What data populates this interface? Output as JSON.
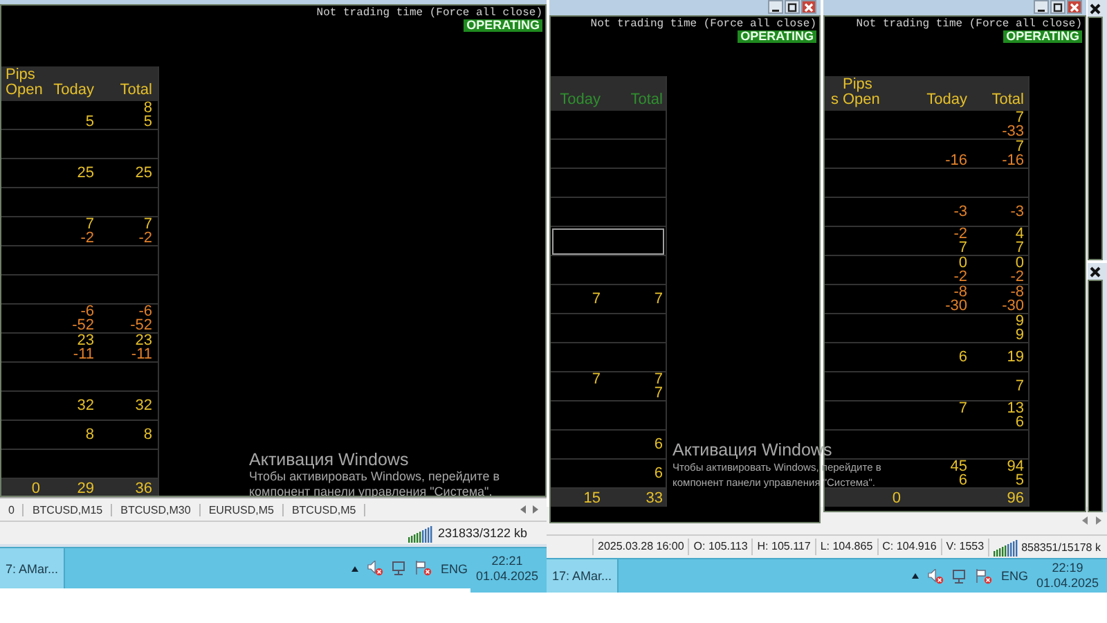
{
  "chart_windows": [
    {
      "has_controls": false,
      "message": "Not trading time (Force all close)",
      "badge": "OPERATING",
      "table": {
        "header_active": true,
        "group_heading": "Pips",
        "columns": [
          "Open",
          "Today",
          "Total"
        ],
        "groups": [
          {
            "kind": "values",
            "lines": [
              {
                "total": {
                  "text": "8",
                  "negative": false
                }
              },
              {
                "today": {
                  "text": "5",
                  "negative": false
                },
                "total": {
                  "text": "5",
                  "negative": false
                }
              }
            ]
          },
          {
            "kind": "empty"
          },
          {
            "kind": "values",
            "lines": [
              {
                "today": {
                  "text": "25",
                  "negative": false
                },
                "total": {
                  "text": "25",
                  "negative": false
                }
              }
            ]
          },
          {
            "kind": "empty"
          },
          {
            "kind": "values",
            "lines": [
              {
                "today": {
                  "text": "7",
                  "negative": false
                },
                "total": {
                  "text": "7",
                  "negative": false
                }
              },
              {
                "today": {
                  "text": "-2",
                  "negative": true
                },
                "total": {
                  "text": "-2",
                  "negative": true
                }
              }
            ]
          },
          {
            "kind": "empty"
          },
          {
            "kind": "empty"
          },
          {
            "kind": "values",
            "lines": [
              {
                "today": {
                  "text": "-6",
                  "negative": true
                },
                "total": {
                  "text": "-6",
                  "negative": true
                }
              },
              {
                "today": {
                  "text": "-52",
                  "negative": true
                },
                "total": {
                  "text": "-52",
                  "negative": true
                }
              }
            ]
          },
          {
            "kind": "values",
            "lines": [
              {
                "today": {
                  "text": "23",
                  "negative": false
                },
                "total": {
                  "text": "23",
                  "negative": false
                }
              },
              {
                "today": {
                  "text": "-11",
                  "negative": true
                },
                "total": {
                  "text": "-11",
                  "negative": true
                }
              }
            ]
          },
          {
            "kind": "empty"
          },
          {
            "kind": "values",
            "lines": [
              {
                "today": {
                  "text": "32",
                  "negative": false
                },
                "total": {
                  "text": "32",
                  "negative": false
                }
              }
            ]
          },
          {
            "kind": "values",
            "lines": [
              {
                "today": {
                  "text": "8",
                  "negative": false
                },
                "total": {
                  "text": "8",
                  "negative": false
                }
              }
            ]
          },
          {
            "kind": "empty"
          }
        ],
        "footer": {
          "open": "0",
          "today": "29",
          "total": "36"
        }
      },
      "tabs": [
        "0",
        "BTCUSD,M15",
        "BTCUSD,M30",
        "EURUSD,M5",
        "BTCUSD,M5"
      ],
      "memory": "231833/3122 kb"
    },
    {
      "has_controls": true,
      "message": "Not trading time (Force all close)",
      "badge": "OPERATING",
      "table": {
        "header_active": false,
        "columns": [
          "Today",
          "Total"
        ],
        "groups": [
          {
            "kind": "empty",
            "selected": false
          },
          {
            "kind": "empty",
            "selected": false
          },
          {
            "kind": "empty",
            "selected": false
          },
          {
            "kind": "empty",
            "selected": false
          },
          {
            "kind": "empty",
            "selected": true
          },
          {
            "kind": "empty",
            "selected": false
          },
          {
            "kind": "values",
            "selected": false,
            "lines": [
              {
                "today": {
                  "text": "7",
                  "negative": false
                },
                "total": {
                  "text": "7",
                  "negative": false
                }
              }
            ]
          },
          {
            "kind": "empty",
            "selected": false
          },
          {
            "kind": "empty",
            "selected": false
          },
          {
            "kind": "values",
            "selected": false,
            "lines": [
              {
                "today": {
                  "text": "7",
                  "negative": false
                },
                "total": {
                  "text": "7",
                  "negative": false
                }
              },
              {
                "total": {
                  "text": "7",
                  "negative": false
                }
              }
            ]
          },
          {
            "kind": "empty",
            "selected": false
          },
          {
            "kind": "values",
            "selected": false,
            "lines": [
              {
                "total": {
                  "text": "6",
                  "negative": false
                }
              }
            ]
          },
          {
            "kind": "values",
            "selected": false,
            "lines": [
              {
                "total": {
                  "text": "6",
                  "negative": false
                }
              }
            ]
          }
        ],
        "footer": {
          "today": "15",
          "total": "33"
        }
      }
    },
    {
      "has_controls": true,
      "message": "Not trading time (Force all close)",
      "badge": "OPERATING",
      "table": {
        "header_active": true,
        "group_heading": "Pips",
        "columns": [
          "s",
          "Open",
          "Today",
          "Total"
        ],
        "groups": [
          {
            "kind": "values",
            "lines": [
              {
                "total": {
                  "text": "7",
                  "negative": false
                }
              },
              {
                "total": {
                  "text": "-33",
                  "negative": true
                }
              }
            ]
          },
          {
            "kind": "values",
            "lines": [
              {
                "total": {
                  "text": "7",
                  "negative": false
                }
              },
              {
                "today": {
                  "text": "-16",
                  "negative": true
                },
                "total": {
                  "text": "-16",
                  "negative": true
                }
              }
            ]
          },
          {
            "kind": "empty"
          },
          {
            "kind": "values",
            "lines": [
              {
                "today": {
                  "text": "-3",
                  "negative": true
                },
                "total": {
                  "text": "-3",
                  "negative": true
                }
              }
            ]
          },
          {
            "kind": "values",
            "lines": [
              {
                "today": {
                  "text": "-2",
                  "negative": true
                },
                "total": {
                  "text": "4",
                  "negative": false
                }
              },
              {
                "today": {
                  "text": "7",
                  "negative": false
                },
                "total": {
                  "text": "7",
                  "negative": false
                }
              }
            ]
          },
          {
            "kind": "values",
            "lines": [
              {
                "today": {
                  "text": "0",
                  "negative": false
                },
                "total": {
                  "text": "0",
                  "negative": false
                }
              },
              {
                "today": {
                  "text": "-2",
                  "negative": true
                },
                "total": {
                  "text": "-2",
                  "negative": true
                }
              }
            ]
          },
          {
            "kind": "values",
            "lines": [
              {
                "today": {
                  "text": "-8",
                  "negative": true
                },
                "total": {
                  "text": "-8",
                  "negative": true
                }
              },
              {
                "today": {
                  "text": "-30",
                  "negative": true
                },
                "total": {
                  "text": "-30",
                  "negative": true
                }
              }
            ]
          },
          {
            "kind": "values",
            "lines": [
              {
                "total": {
                  "text": "9",
                  "negative": false
                }
              },
              {
                "total": {
                  "text": "9",
                  "negative": false
                }
              }
            ]
          },
          {
            "kind": "values",
            "lines": [
              {
                "today": {
                  "text": "6",
                  "negative": false
                },
                "total": {
                  "text": "19",
                  "negative": false
                }
              }
            ]
          },
          {
            "kind": "values",
            "lines": [
              {
                "total": {
                  "text": "7",
                  "negative": false
                }
              }
            ]
          },
          {
            "kind": "values",
            "lines": [
              {
                "today": {
                  "text": "7",
                  "negative": false
                },
                "total": {
                  "text": "13",
                  "negative": false
                }
              },
              {
                "total": {
                  "text": "6",
                  "negative": false
                }
              }
            ]
          },
          {
            "kind": "empty"
          },
          {
            "kind": "values",
            "lines": [
              {
                "today": {
                  "text": "45",
                  "negative": false
                },
                "total": {
                  "text": "94",
                  "negative": false
                }
              },
              {
                "today": {
                  "text": "6",
                  "negative": false
                },
                "total": {
                  "text": "5",
                  "negative": false
                }
              }
            ]
          }
        ],
        "footer": {
          "open": "0",
          "total": "96"
        }
      }
    }
  ],
  "background_window": {
    "status_cells": [
      "2025.03.28 16:00",
      "O: 105.113",
      "H: 105.117",
      "L: 104.865",
      "C: 104.916",
      "V: 1553"
    ],
    "memory": "858351/15178 k"
  },
  "taskbars": [
    {
      "button": "7: AMar...",
      "language": "ENG",
      "time": "22:21",
      "date": "01.04.2025"
    },
    {
      "button": "17: AMar...",
      "language": "ENG",
      "time": "22:19",
      "date": "01.04.2025"
    }
  ],
  "activation_notices": [
    {
      "title": "Активация Windows",
      "lines": [
        "Чтобы активировать Windows, перейдите в",
        "компонент панели управления \"Система\"."
      ]
    },
    {
      "title": "Активация Windows",
      "lines": [
        "Чтобы активировать Windows, перейдите в",
        "компонент панели управления \"Система\"."
      ]
    }
  ]
}
